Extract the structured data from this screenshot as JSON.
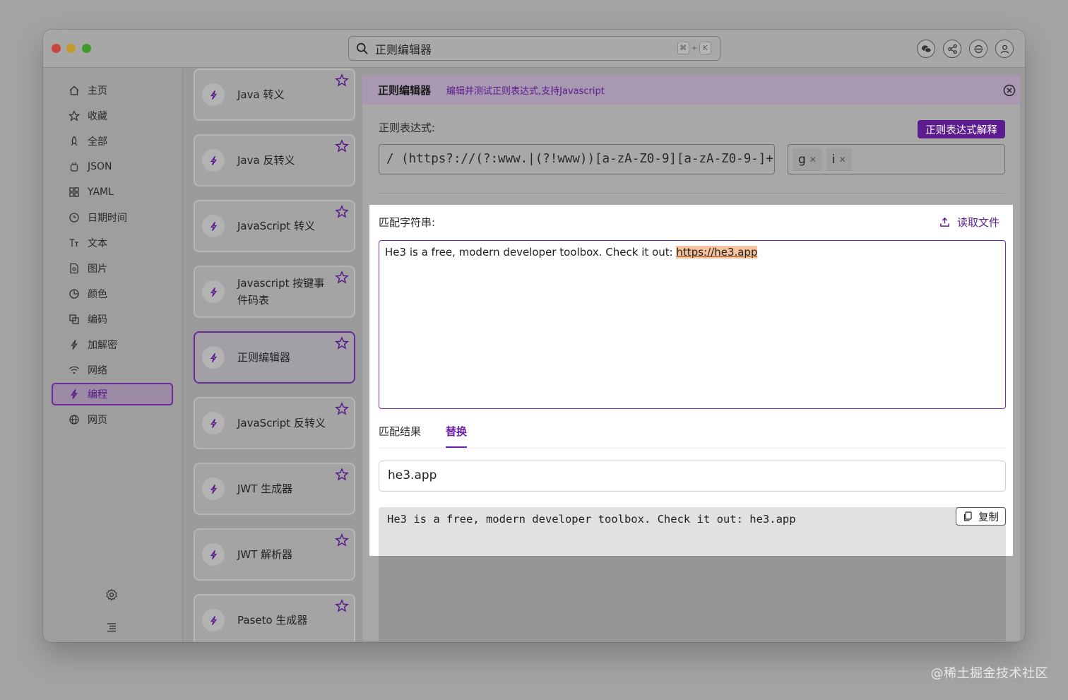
{
  "search": {
    "text": "正则编辑器",
    "shortcut_mod": "⌘",
    "shortcut_plus": "+",
    "shortcut_key": "K"
  },
  "toolbar_icons": [
    "wechat-icon",
    "share-icon",
    "sync-icon",
    "user-icon"
  ],
  "sidebar": {
    "items": [
      {
        "label": "主页",
        "icon": "home-icon"
      },
      {
        "label": "收藏",
        "icon": "star-icon"
      },
      {
        "label": "全部",
        "icon": "rocket-icon"
      },
      {
        "label": "JSON",
        "icon": "json-icon"
      },
      {
        "label": "YAML",
        "icon": "grid-icon"
      },
      {
        "label": "日期时间",
        "icon": "clock-icon"
      },
      {
        "label": "文本",
        "icon": "text-icon"
      },
      {
        "label": "图片",
        "icon": "image-icon"
      },
      {
        "label": "颜色",
        "icon": "palette-icon"
      },
      {
        "label": "编码",
        "icon": "encode-icon"
      },
      {
        "label": "加解密",
        "icon": "lightning-icon"
      },
      {
        "label": "网络",
        "icon": "wifi-icon"
      },
      {
        "label": "编程",
        "icon": "lightning-icon",
        "active": true
      },
      {
        "label": "网页",
        "icon": "globe-icon"
      }
    ]
  },
  "tools": [
    {
      "title": "Java 转义"
    },
    {
      "title": "Java 反转义"
    },
    {
      "title": "JavaScript 转义"
    },
    {
      "title": "Javascript 按键事件码表"
    },
    {
      "title": "正则编辑器",
      "selected": true
    },
    {
      "title": "JavaScript 反转义"
    },
    {
      "title": "JWT 生成器"
    },
    {
      "title": "JWT 解析器"
    },
    {
      "title": "Paseto 生成器"
    }
  ],
  "panel": {
    "title": "正则编辑器",
    "description": "编辑并测试正则表达式,支持Javascript",
    "regex_label": "正则表达式:",
    "explain_button": "正则表达式解释",
    "regex_value": "/ (https?://(?:www.|(?!www))[a-zA-Z0-9][a-zA-Z0-9-]+",
    "flags": [
      "g",
      "i"
    ],
    "match_label": "匹配字符串:",
    "read_file": "读取文件",
    "match_text_before": "He3 is a free, modern developer toolbox. Check it out: ",
    "match_text_highlight": "https://he3.app",
    "tabs": [
      "匹配结果",
      "替换"
    ],
    "active_tab": "替换",
    "replace_value": "he3.app",
    "result_text": "He3 is a free, modern developer toolbox. Check it out: he3.app",
    "copy_button": "复制"
  },
  "watermark": "@稀土掘金技术社区",
  "colors": {
    "accent": "#6a1fa8",
    "highlight": "#f6c29d"
  }
}
